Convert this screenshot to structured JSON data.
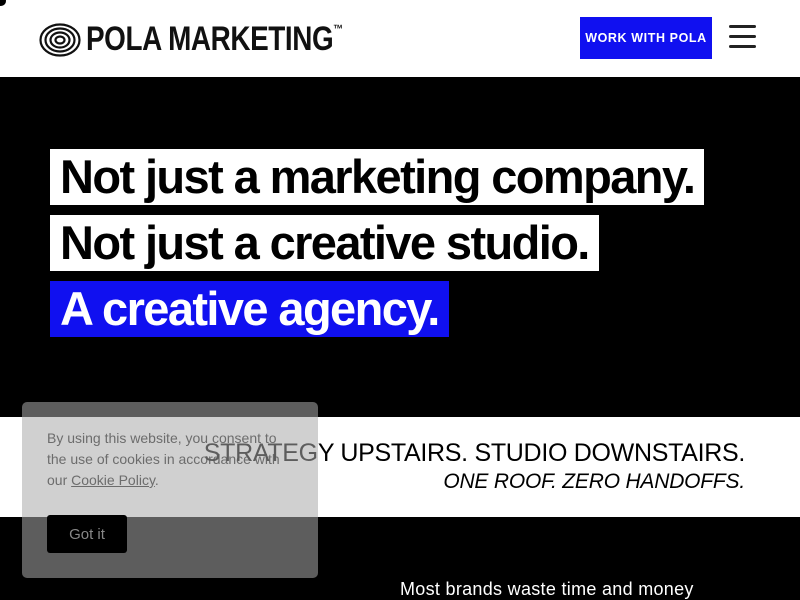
{
  "header": {
    "logo_text": "POLA MARKETING",
    "logo_tm": "™",
    "cta_label": "WORK WITH POLA",
    "menu_icon": "hamburger-icon"
  },
  "hero": {
    "line1": "Not just a marketing company.",
    "line2": "Not just a creative studio.",
    "line3": "A creative agency."
  },
  "band": {
    "line1": "STRATEGY UPSTAIRS. STUDIO DOWNSTAIRS.",
    "line2": "ONE ROOF. ZERO HANDOFFS."
  },
  "intro": {
    "text": "Most brands waste time and money"
  },
  "cookie": {
    "text_before": "By using this website, you consent to the use of cookies in accordance with our ",
    "link_label": "Cookie Policy",
    "text_after": ".",
    "button_label": "Got it"
  },
  "colors": {
    "accent": "#1010f0",
    "background": "#000000",
    "header_bg": "#ffffff"
  }
}
